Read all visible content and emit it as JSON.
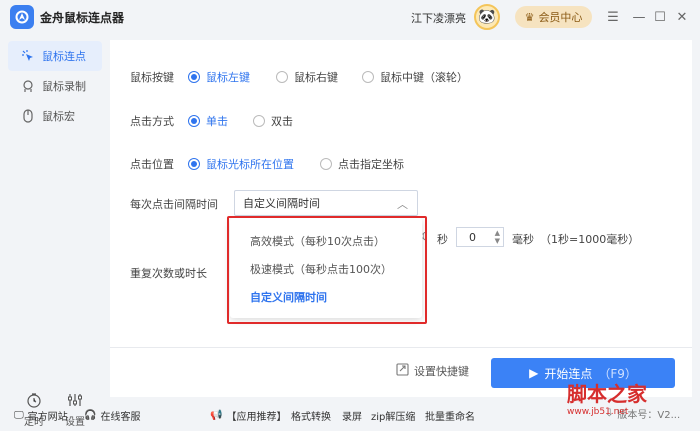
{
  "app": {
    "title": "金舟鼠标连点器"
  },
  "header": {
    "username": "江下凌漂亮",
    "vip_label": "会员中心"
  },
  "sidebar": {
    "items": [
      {
        "label": "鼠标连点",
        "icon": "click-icon",
        "active": true
      },
      {
        "label": "鼠标录制",
        "icon": "record-icon",
        "active": false
      },
      {
        "label": "鼠标宏",
        "icon": "mouse-icon",
        "active": false
      }
    ],
    "bottom": [
      {
        "label": "定时",
        "icon": "timer-icon"
      },
      {
        "label": "设置",
        "icon": "settings-icon"
      }
    ]
  },
  "form": {
    "mouse_button": {
      "label": "鼠标按键",
      "options": [
        "鼠标左键",
        "鼠标右键",
        "鼠标中键（滚轮）"
      ],
      "selected": 0
    },
    "click_mode": {
      "label": "点击方式",
      "options": [
        "单击",
        "双击"
      ],
      "selected": 0
    },
    "click_position": {
      "label": "点击位置",
      "options": [
        "鼠标光标所在位置",
        "点击指定坐标"
      ],
      "selected": 0
    },
    "interval": {
      "label": "每次点击间隔时间",
      "value": "自定义间隔时间",
      "options": [
        "高效模式（每秒10次点击）",
        "极速模式（每秒点击100次）",
        "自定义间隔时间"
      ],
      "selected": 2,
      "seconds_unit": "秒",
      "ms_value": "0",
      "ms_unit": "毫秒",
      "hint": "（1秒=1000毫秒）"
    },
    "repeat": {
      "label": "重复次数或时长"
    }
  },
  "actions": {
    "shortcut_label": "设置快捷键",
    "start_label": "开始连点",
    "start_hotkey": "（F9）"
  },
  "footer": {
    "website": "官方网站",
    "support": "在线客服",
    "recommend": "【应用推荐】",
    "apps": [
      "格式转换",
      "录屏",
      "zip解压缩",
      "批量重命名"
    ],
    "version": "版本号：V2..."
  },
  "watermark": {
    "text": "脚本之家",
    "url": "www.jb51.net"
  },
  "colors": {
    "accent": "#2f74ee",
    "highlight": "#e02a2a",
    "vip": "#f6e3c0"
  }
}
